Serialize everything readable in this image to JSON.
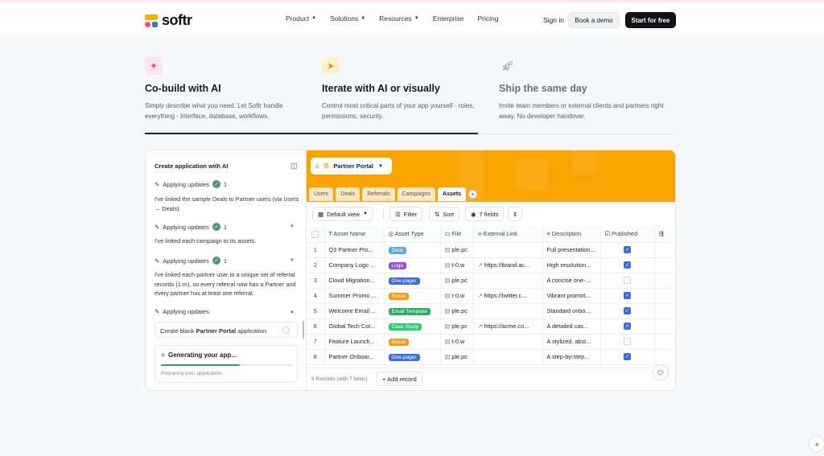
{
  "brand": {
    "name": "softr"
  },
  "nav": {
    "items": [
      "Product",
      "Solutions",
      "Resources",
      "Enterprise",
      "Pricing"
    ],
    "signin": "Sign in",
    "demo": "Book a demo",
    "start": "Start for free"
  },
  "features": [
    {
      "title": "Co-build with AI",
      "text": "Simply describe what you need. Let Softr handle everything - Interface, database, workflows.",
      "icon": "magic-wand-icon"
    },
    {
      "title": "Iterate with AI or visually",
      "text": "Control most critical parts of your app yourself - roles, permissions, security.",
      "icon": "cursor-click-icon"
    },
    {
      "title": "Ship the same day",
      "text": "Invite team members or external clients and partners right away. No developer handover.",
      "icon": "rocket-icon"
    }
  ],
  "sidebar": {
    "title": "Create application with AI",
    "updates": [
      {
        "label": "Applying updates",
        "count": "1",
        "msg": "I've linked the sample Deals to Partner users (via Users → Deals)."
      },
      {
        "label": "Applying updates",
        "count": "1",
        "msg": "I've linked each campaign to its assets."
      },
      {
        "label": "Applying updates",
        "count": "1",
        "msg": "I've linked each partner user to a unique set of referral records (1:m), so every referral now has a Partner and every partner has at least one referral."
      },
      {
        "label": "Applying updates"
      }
    ],
    "task_pre": "Create blank ",
    "task_bold": "Partner Portal",
    "task_post": " application",
    "generating": "Generating your app...",
    "progress": 0.6,
    "preparing": "Preparing your application"
  },
  "app": {
    "portal": "Partner Portal",
    "tabs": [
      "Users",
      "Deals",
      "Referrals",
      "Campaigns",
      "Assets"
    ],
    "active_tab": "Assets",
    "toolbar": {
      "view": "Default view",
      "filter": "Filter",
      "sort": "Sort",
      "fields": "7 fields"
    },
    "columns": [
      "Asset Name",
      "Asset Type",
      "File",
      "External Link",
      "Description",
      "Published"
    ],
    "rows": [
      {
        "n": "1",
        "name": "Q3 Partner Pro...",
        "type": "Deck",
        "color": "#5aa9e6",
        "file": "ple.pc",
        "link": "",
        "desc": "Full presentation...",
        "pub": true
      },
      {
        "n": "2",
        "name": "Company Logo ...",
        "type": "Logo",
        "color": "#9b4fd1",
        "file": "t-0.w",
        "link": "https://brand.ac...",
        "desc": "High resolution...",
        "pub": true
      },
      {
        "n": "3",
        "name": "Cloud Migration...",
        "type": "One-pager",
        "color": "#3b6ce8",
        "file": "ple.pc",
        "link": "",
        "desc": "A concise one-...",
        "pub": false
      },
      {
        "n": "4",
        "name": "Summer Promo ...",
        "type": "Social",
        "color": "#f39c12",
        "file": "t-0.w",
        "link": "https://twitter.c...",
        "desc": "Vibrant promot...",
        "pub": true
      },
      {
        "n": "5",
        "name": "Welcome Email ...",
        "type": "Email Template",
        "color": "#27ae60",
        "file": "ple.pc",
        "link": "",
        "desc": "Standard onbo...",
        "pub": true
      },
      {
        "n": "6",
        "name": "Global Tech Cor...",
        "type": "Case Study",
        "color": "#2ecc71",
        "file": "ple.pc",
        "link": "https://acme.co...",
        "desc": "A detailed cas...",
        "pub": true
      },
      {
        "n": "7",
        "name": "Feature Launch...",
        "type": "Social",
        "color": "#f39c12",
        "file": "t-0.w",
        "link": "",
        "desc": "A stylized, abst...",
        "pub": false
      },
      {
        "n": "8",
        "name": "Partner Onboar...",
        "type": "One-pager",
        "color": "#3b6ce8",
        "file": "ple.pc",
        "link": "",
        "desc": "A step-by-step...",
        "pub": true
      }
    ],
    "footer": {
      "count": "8 Records (with 7 fields)",
      "add": "+ Add record"
    }
  }
}
